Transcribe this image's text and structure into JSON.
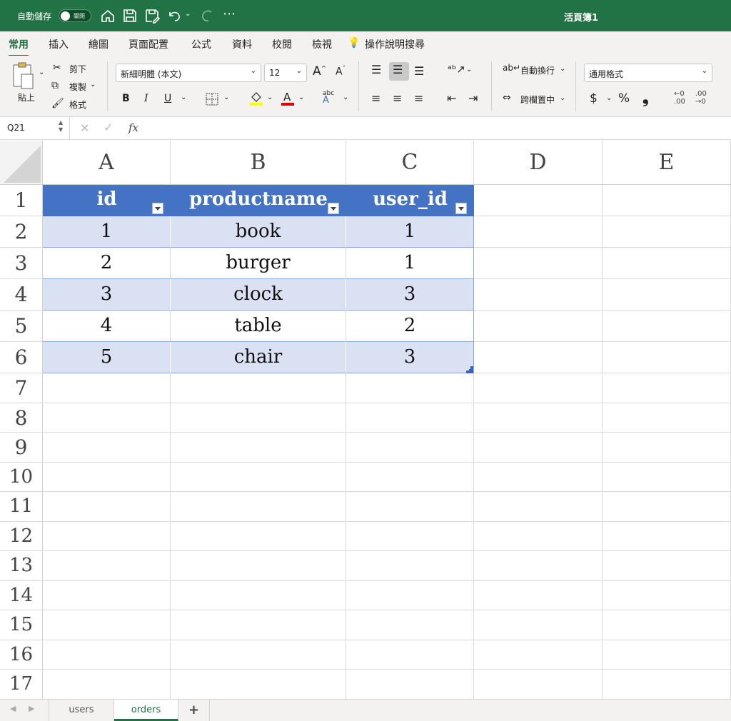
{
  "titlebar": {
    "autosave_label": "自動儲存",
    "autosave_state": "關閉",
    "title": "活頁簿1",
    "icons": [
      "home-icon",
      "save-icon",
      "save-as-icon",
      "undo-icon",
      "redo-icon",
      "more-icon"
    ]
  },
  "tabs": [
    "常用",
    "插入",
    "繪圖",
    "頁面配置",
    "公式",
    "資料",
    "校閱",
    "檢視",
    "操作說明搜尋"
  ],
  "ribbon": {
    "paste": "貼上",
    "cut": "剪下",
    "copy": "複製",
    "format_painter": "格式",
    "font_name": "新細明體 (本文)",
    "font_size": "12",
    "bold": "B",
    "italic": "I",
    "underline": "U",
    "wrap_text": "自動換行",
    "merge_center": "跨欄置中",
    "number_format": "通用格式",
    "currency": "$",
    "percent": "%",
    "comma": "❟",
    "font_color": "#e60000",
    "highlight_color": "#ffff00"
  },
  "formula_bar": {
    "name_box": "Q21",
    "fx": "fx",
    "value": ""
  },
  "sheet": {
    "columns": [
      "A",
      "B",
      "C",
      "D",
      "E"
    ],
    "rows": [
      "1",
      "2",
      "3",
      "4",
      "5",
      "6",
      "7",
      "8",
      "9",
      "10",
      "11",
      "12",
      "13",
      "14",
      "15",
      "16",
      "17"
    ],
    "table": {
      "headers": [
        "id",
        "productname",
        "user_id"
      ],
      "data": [
        [
          "1",
          "book",
          "1"
        ],
        [
          "2",
          "burger",
          "1"
        ],
        [
          "3",
          "clock",
          "3"
        ],
        [
          "4",
          "table",
          "2"
        ],
        [
          "5",
          "chair",
          "3"
        ]
      ],
      "header_color": "#4472c4",
      "band_color": "#d9e1f2"
    }
  },
  "sheet_tabs": {
    "tabs": [
      "users",
      "orders"
    ],
    "active": "orders",
    "add": "+"
  }
}
